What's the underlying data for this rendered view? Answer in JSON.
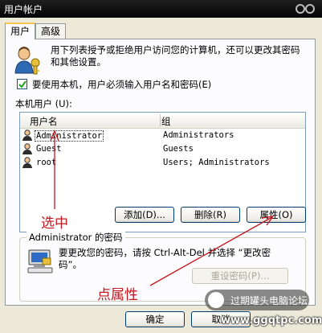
{
  "window": {
    "title": "用户帐户"
  },
  "tabs": [
    {
      "label": "用户"
    },
    {
      "label": "高级"
    }
  ],
  "intro_text": "用下列表授予或拒绝用户访问您的计算机，还可以更改其密码和其他设置。",
  "require_password": {
    "label": "要使用本机，用户必须输入用户名和密码(E)",
    "checked": true
  },
  "users_label": "本机用户 (U):",
  "user_list": {
    "columns": [
      "用户名",
      "组"
    ],
    "rows": [
      {
        "name": "Administrator",
        "group": "Administrators"
      },
      {
        "name": "Guest",
        "group": "Guests"
      },
      {
        "name": "root",
        "group": "Users; Administrators"
      }
    ]
  },
  "buttons": {
    "add": "添加(D)...",
    "remove": "删除(R)",
    "properties": "属性(O)",
    "reset_password": "重设密码(P)...",
    "ok": "确定",
    "cancel": "取消"
  },
  "password_group": {
    "title": "Administrator 的密码",
    "text": "要更改您的密码，请按 Ctrl-Alt-Del 并选择 “更改密码”。"
  },
  "annotations": {
    "select": "选中",
    "click_properties": "点属性"
  },
  "watermark": {
    "text": "过期罐头电脑论坛",
    "url": "www.ggqtpc.com"
  },
  "colors": {
    "annotation": "#C4161C",
    "titlebar": "#0A0A0A",
    "panel": "#FCFCFE"
  }
}
